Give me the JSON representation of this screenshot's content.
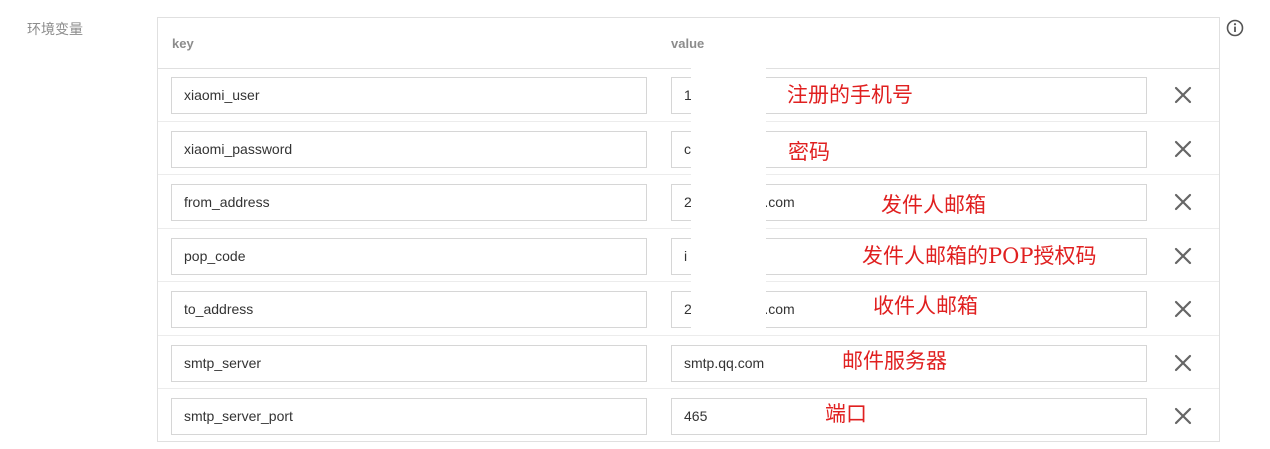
{
  "section": {
    "label": "环境变量"
  },
  "table": {
    "headers": {
      "key": "key",
      "value": "value"
    },
    "rows": [
      {
        "key": "xiaomi_user",
        "value": "1"
      },
      {
        "key": "xiaomi_password",
        "value": "c"
      },
      {
        "key": "from_address",
        "value": "2           @qq.com"
      },
      {
        "key": "pop_code",
        "value": "i"
      },
      {
        "key": "to_address",
        "value": "2           @qq.com"
      },
      {
        "key": "smtp_server",
        "value": "smtp.qq.com"
      },
      {
        "key": "smtp_server_port",
        "value": "465"
      }
    ]
  },
  "annotations": {
    "xiaomi_user": "注册的手机号",
    "xiaomi_password": "密码",
    "from_address": "发件人邮箱",
    "pop_code": "发件人邮箱的POP授权码",
    "to_address": "收件人邮箱",
    "smtp_server": "邮件服务器",
    "smtp_server_port": "端口"
  },
  "icons": {
    "info": "info-icon",
    "remove": "close-icon"
  },
  "colors": {
    "annotation": "#e02020",
    "border": "#e0e0e0",
    "label": "#8c8c8c"
  }
}
